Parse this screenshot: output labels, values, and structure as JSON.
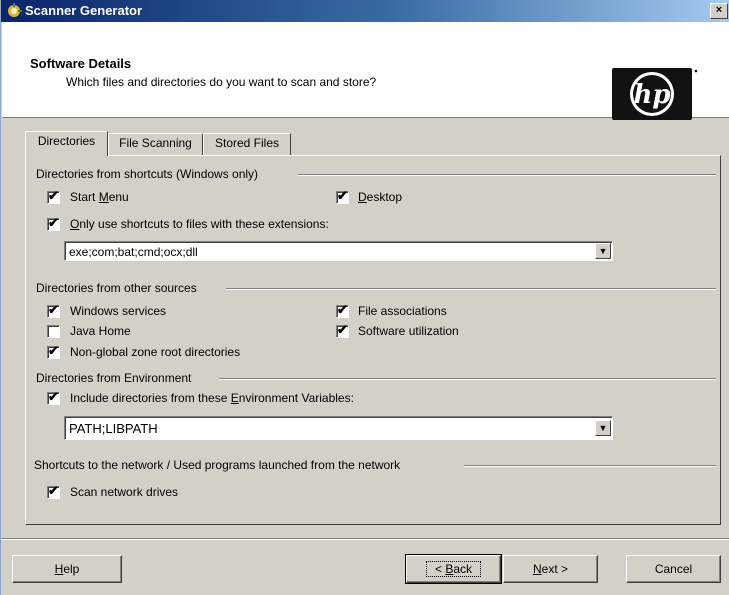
{
  "window": {
    "title": "Scanner Generator",
    "close_glyph": "×"
  },
  "header": {
    "title": "Software Details",
    "subtitle": "Which files and directories do you want to scan and store?",
    "logo_text": "hp"
  },
  "tabs": [
    {
      "label": "Directories",
      "active": true
    },
    {
      "label": "File Scanning",
      "active": false
    },
    {
      "label": "Stored Files",
      "active": false
    }
  ],
  "groups": {
    "shortcuts": {
      "title": "Directories from shortcuts (Windows only)",
      "start_menu": {
        "pre": "Start ",
        "u": "M",
        "post": "enu",
        "checked": true
      },
      "desktop": {
        "pre": "",
        "u": "D",
        "post": "esktop",
        "checked": true
      },
      "only_use": {
        "pre": "",
        "u": "O",
        "post": "nly use shortcuts to files with these extensions:",
        "checked": true
      },
      "extensions_value": "exe;com;bat;cmd;ocx;dll"
    },
    "other_sources": {
      "title": "Directories from other sources",
      "windows_services": {
        "label": "Windows services",
        "checked": true
      },
      "java_home": {
        "label": "Java Home",
        "checked": false
      },
      "non_global": {
        "label": "Non-global zone root directories",
        "checked": true
      },
      "file_associations": {
        "label": "File associations",
        "checked": true
      },
      "software_utilization": {
        "label": "Software utilization",
        "checked": true
      }
    },
    "environment": {
      "title": "Directories from Environment",
      "include": {
        "pre": "Include directories from these ",
        "u": "E",
        "post": "nvironment Variables:",
        "checked": true
      },
      "env_value": "PATH;LIBPATH"
    },
    "network": {
      "title": "Shortcuts to the network / Used programs launched from the network",
      "scan_network": {
        "label": "Scan network drives",
        "checked": true
      }
    }
  },
  "buttons": {
    "help": {
      "u": "H",
      "post": "elp"
    },
    "back": {
      "pre": "< ",
      "u": "B",
      "post": "ack"
    },
    "next": {
      "u": "N",
      "post": "ext >"
    },
    "cancel": {
      "label": "Cancel"
    }
  },
  "check_glyph": "✔",
  "arrow_glyph": "▼"
}
